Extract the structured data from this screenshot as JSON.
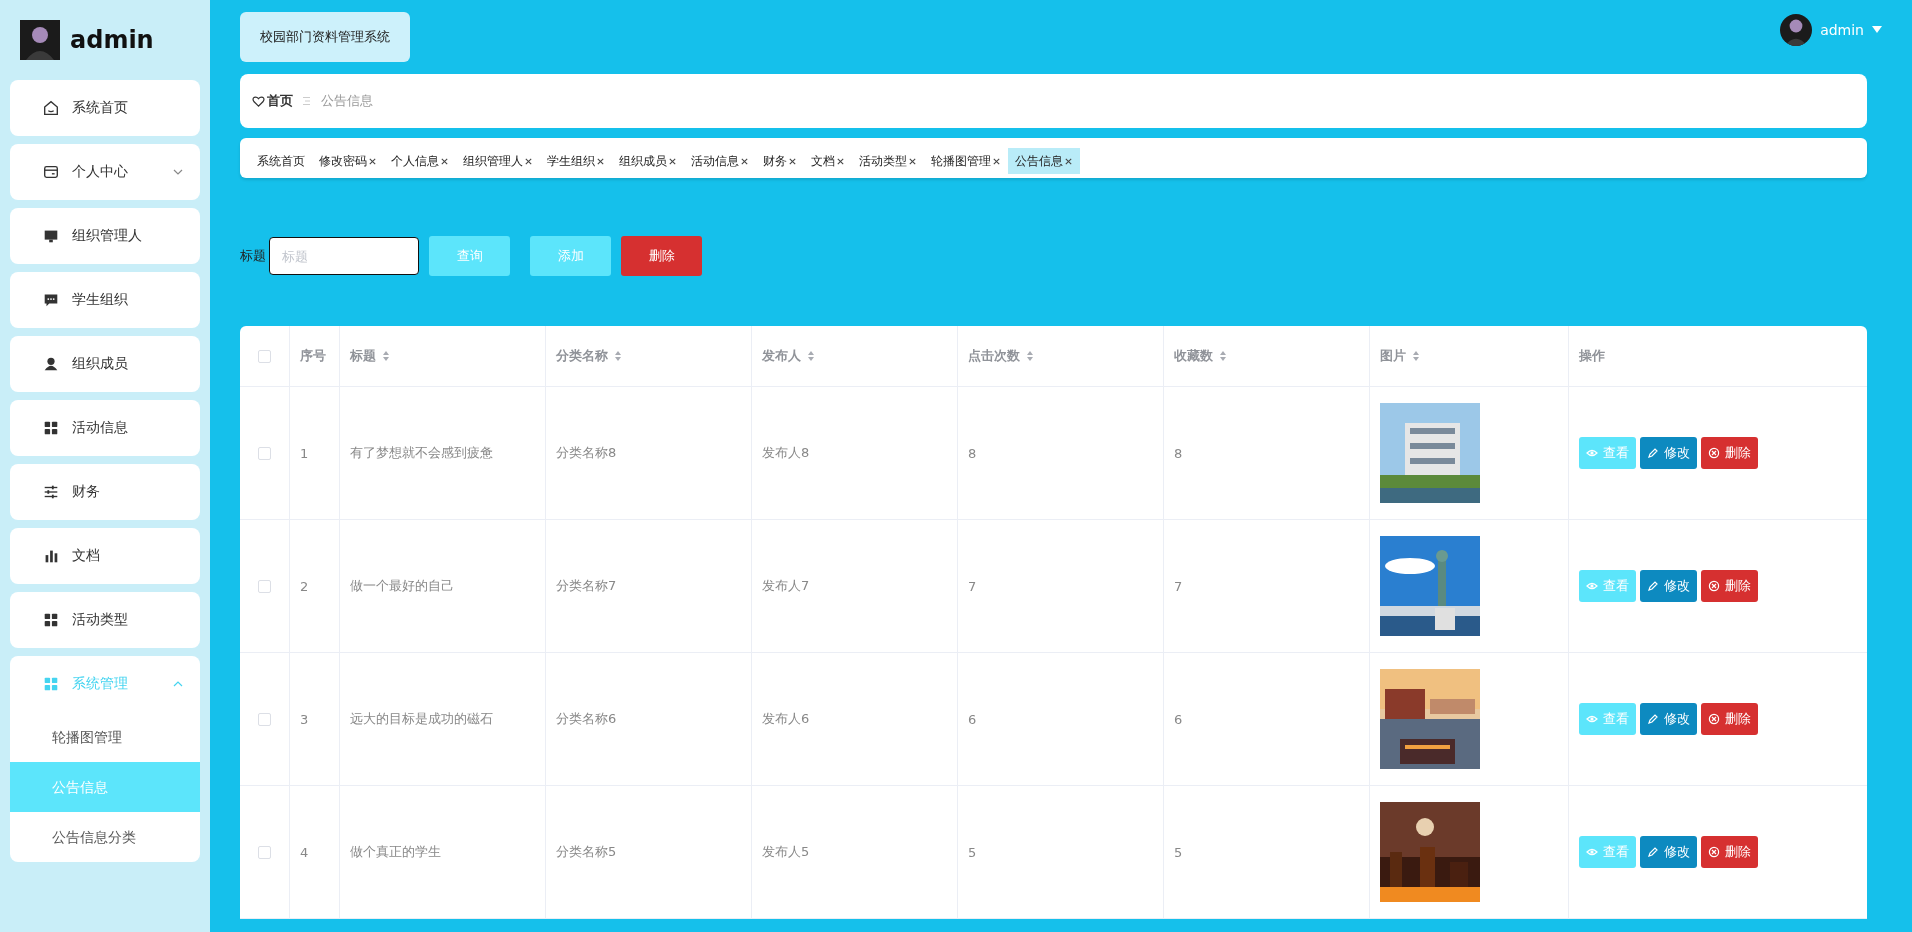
{
  "sidebar": {
    "user": "admin",
    "menu": [
      {
        "label": "系统首页"
      },
      {
        "label": "个人中心",
        "expanded": false
      },
      {
        "label": "组织管理人"
      },
      {
        "label": "学生组织"
      },
      {
        "label": "组织成员"
      },
      {
        "label": "活动信息"
      },
      {
        "label": "财务"
      },
      {
        "label": "文档"
      },
      {
        "label": "活动类型"
      },
      {
        "label": "系统管理",
        "expanded": true,
        "children": [
          {
            "label": "轮播图管理",
            "selected": false
          },
          {
            "label": "公告信息",
            "selected": true
          },
          {
            "label": "公告信息分类",
            "selected": false
          }
        ]
      }
    ]
  },
  "header": {
    "system_title": "校园部门资料管理系统",
    "user": "admin"
  },
  "breadcrumb": {
    "home": "首页",
    "current": "公告信息"
  },
  "tabs": [
    {
      "label": "系统首页",
      "closable": false,
      "selected": false
    },
    {
      "label": "修改密码",
      "closable": true,
      "selected": false
    },
    {
      "label": "个人信息",
      "closable": true,
      "selected": false
    },
    {
      "label": "组织管理人",
      "closable": true,
      "selected": false
    },
    {
      "label": "学生组织",
      "closable": true,
      "selected": false
    },
    {
      "label": "组织成员",
      "closable": true,
      "selected": false
    },
    {
      "label": "活动信息",
      "closable": true,
      "selected": false
    },
    {
      "label": "财务",
      "closable": true,
      "selected": false
    },
    {
      "label": "文档",
      "closable": true,
      "selected": false
    },
    {
      "label": "活动类型",
      "closable": true,
      "selected": false
    },
    {
      "label": "轮播图管理",
      "closable": true,
      "selected": false
    },
    {
      "label": "公告信息",
      "closable": true,
      "selected": true
    }
  ],
  "search": {
    "label": "标题",
    "placeholder": "标题",
    "buttons": [
      {
        "label": "查询",
        "kind": "search"
      },
      {
        "label": "添加",
        "kind": "add"
      },
      {
        "label": "删除",
        "kind": "delete"
      }
    ]
  },
  "table": {
    "all_checked": false,
    "columns": [
      {
        "label": "序号",
        "sortable": false
      },
      {
        "label": "标题",
        "sortable": true
      },
      {
        "label": "分类名称",
        "sortable": true
      },
      {
        "label": "发布人",
        "sortable": true
      },
      {
        "label": "点击次数",
        "sortable": true
      },
      {
        "label": "收藏数",
        "sortable": true
      },
      {
        "label": "图片",
        "sortable": true
      },
      {
        "label": "操作",
        "sortable": false
      }
    ],
    "rows": [
      {
        "checked": false,
        "cells": [
          "1",
          "有了梦想就不会感到疲惫",
          "分类名称8",
          "发布人8",
          "8",
          "8"
        ],
        "image": {
          "kind": "picture"
        },
        "actions": [
          {
            "label": "查看",
            "kind": "view"
          },
          {
            "label": "修改",
            "kind": "edit"
          },
          {
            "label": "删除",
            "kind": "delete"
          }
        ]
      },
      {
        "checked": false,
        "cells": [
          "2",
          "做一个最好的自己",
          "分类名称7",
          "发布人7",
          "7",
          "7"
        ],
        "image": {
          "kind": "picture"
        },
        "actions": [
          {
            "label": "查看",
            "kind": "view"
          },
          {
            "label": "修改",
            "kind": "edit"
          },
          {
            "label": "删除",
            "kind": "delete"
          }
        ]
      },
      {
        "checked": false,
        "cells": [
          "3",
          "远大的目标是成功的磁石",
          "分类名称6",
          "发布人6",
          "6",
          "6"
        ],
        "image": {
          "kind": "picture"
        },
        "actions": [
          {
            "label": "查看",
            "kind": "view"
          },
          {
            "label": "修改",
            "kind": "edit"
          },
          {
            "label": "删除",
            "kind": "delete"
          }
        ]
      },
      {
        "checked": false,
        "cells": [
          "4",
          "做个真正的学生",
          "分类名称5",
          "发布人5",
          "5",
          "5"
        ],
        "image": {
          "kind": "picture"
        },
        "actions": [
          {
            "label": "查看",
            "kind": "view"
          },
          {
            "label": "修改",
            "kind": "edit"
          },
          {
            "label": "删除",
            "kind": "delete"
          }
        ]
      }
    ]
  }
}
